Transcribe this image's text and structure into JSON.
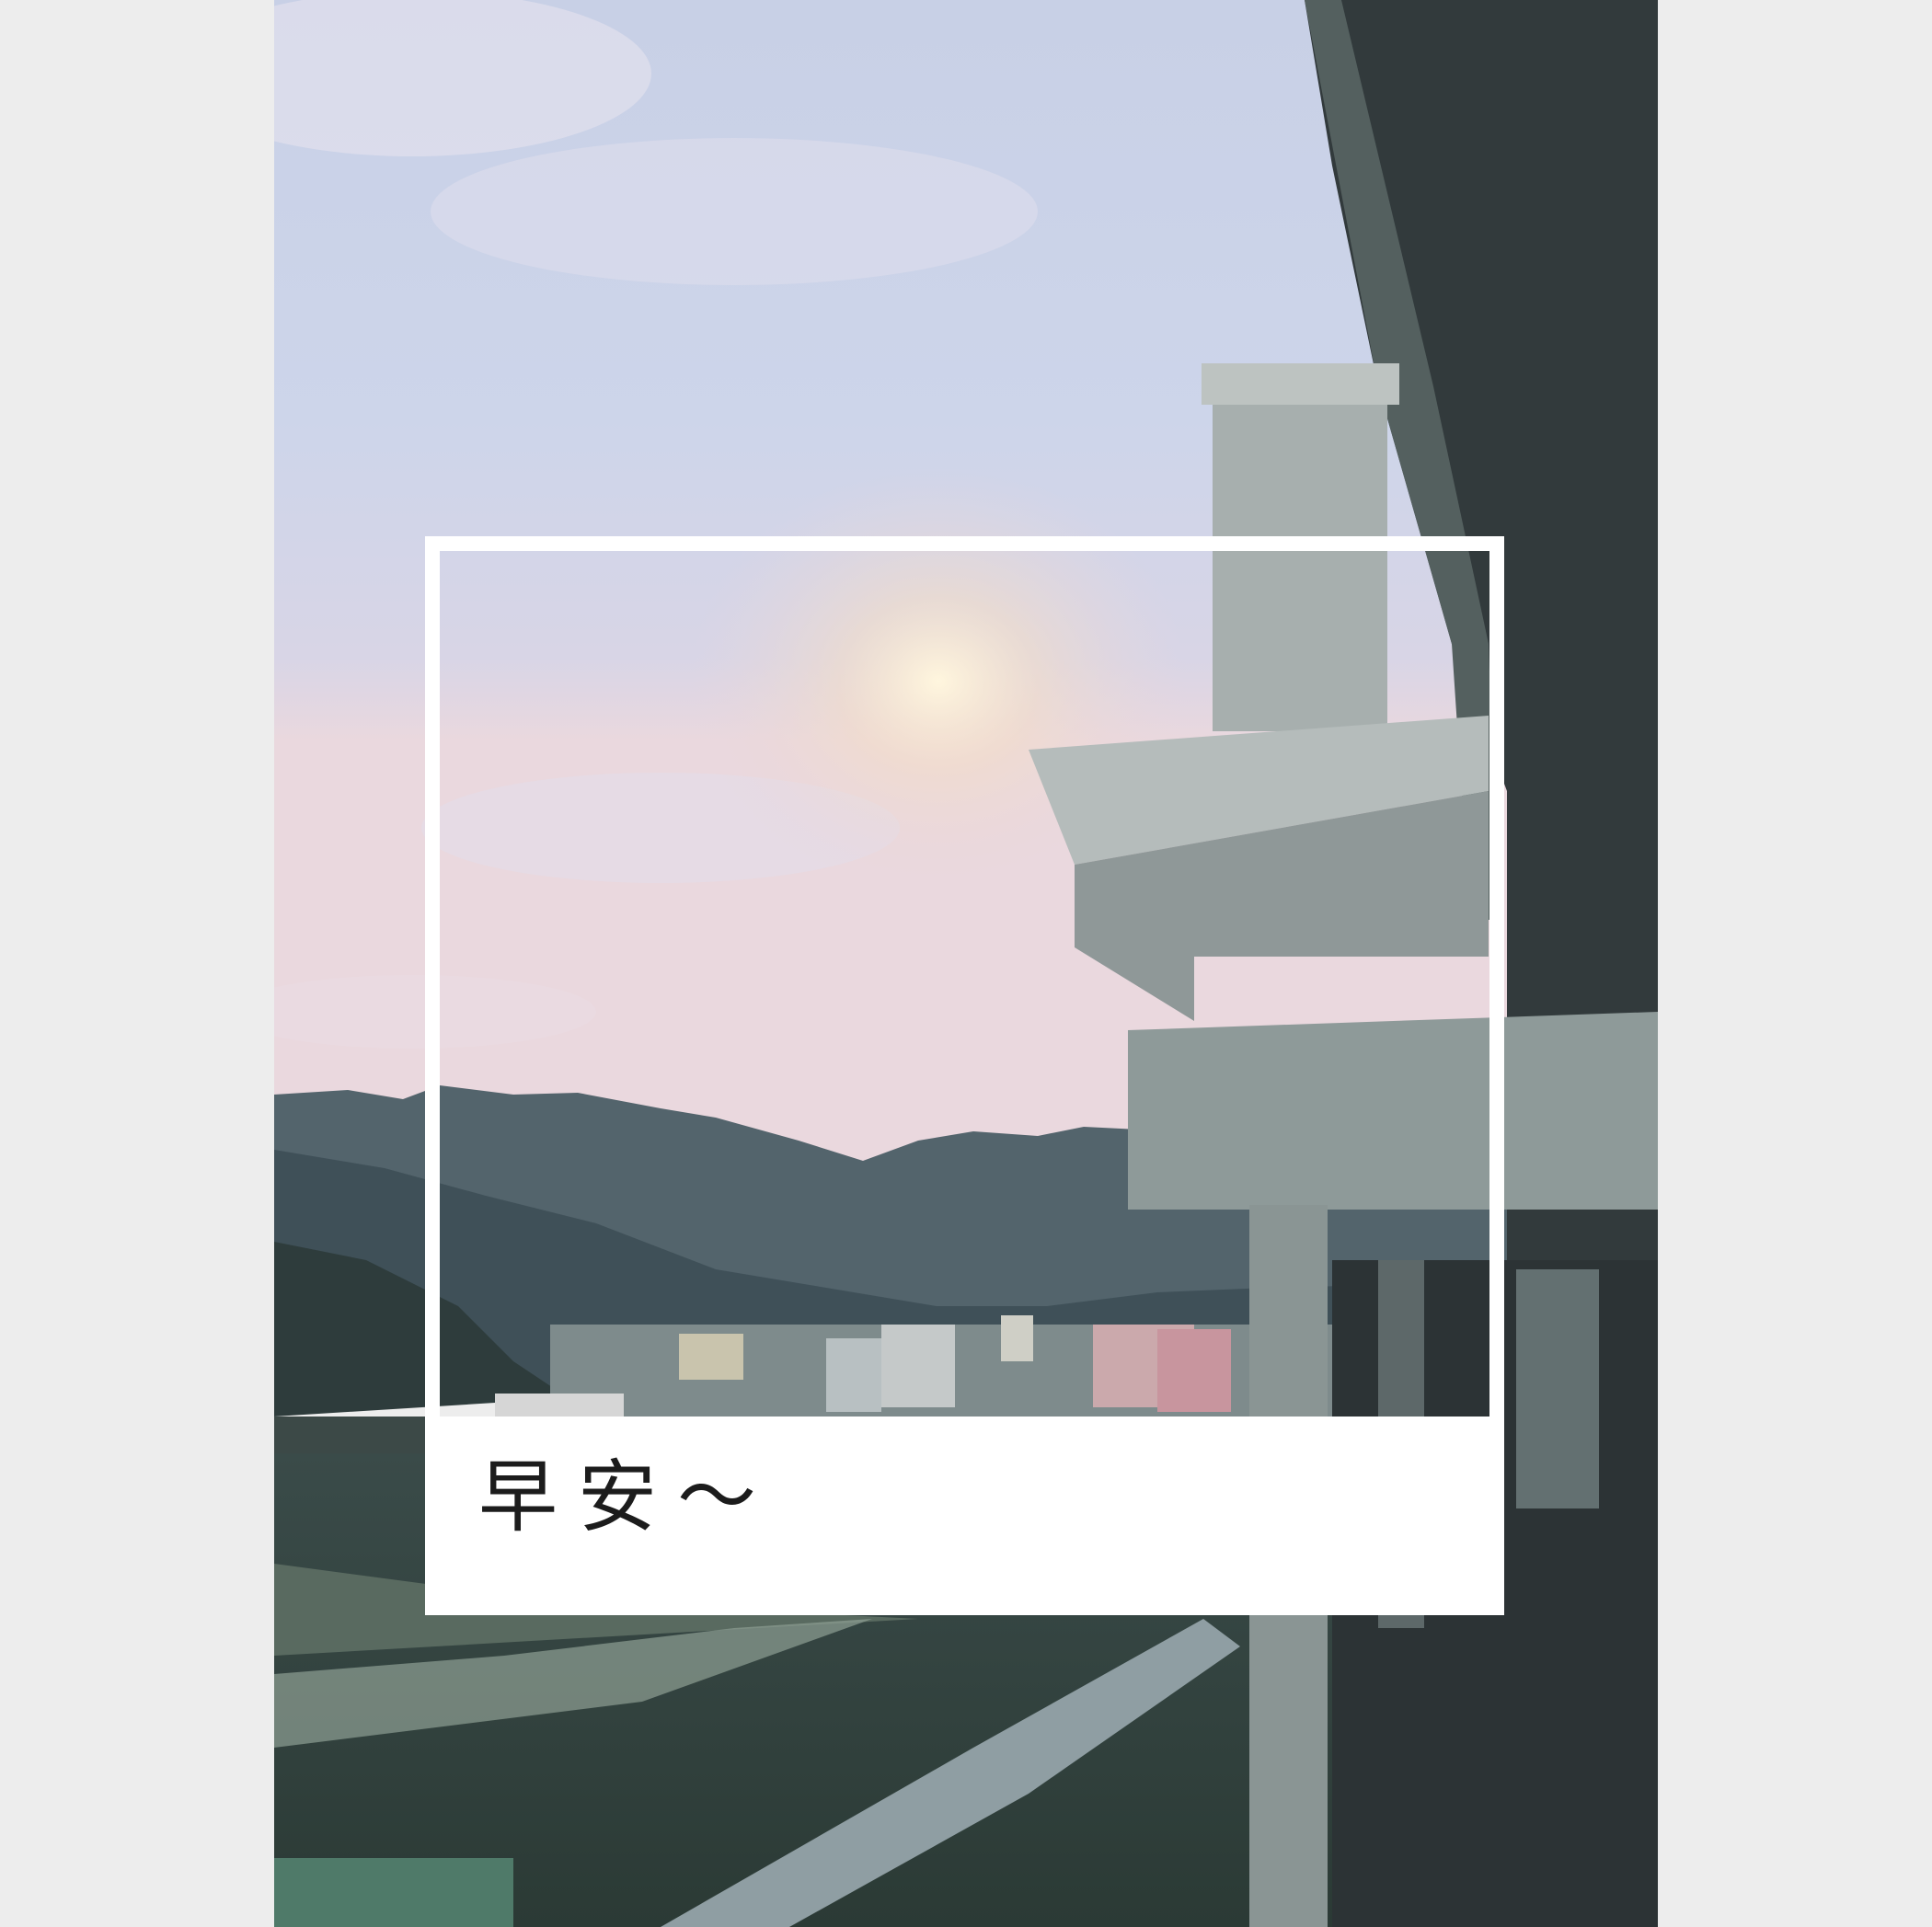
{
  "caption": "早安～",
  "colors": {
    "page_background": "#ededed",
    "frame": "#ffffff",
    "sky_top": "#c9d3ea",
    "sky_bottom": "#e8d6dc",
    "mountains": "#3e5058",
    "building": "#8e9c9c"
  },
  "scene": {
    "description_icons": [
      "sky",
      "mountains",
      "city",
      "balcony",
      "river"
    ]
  }
}
